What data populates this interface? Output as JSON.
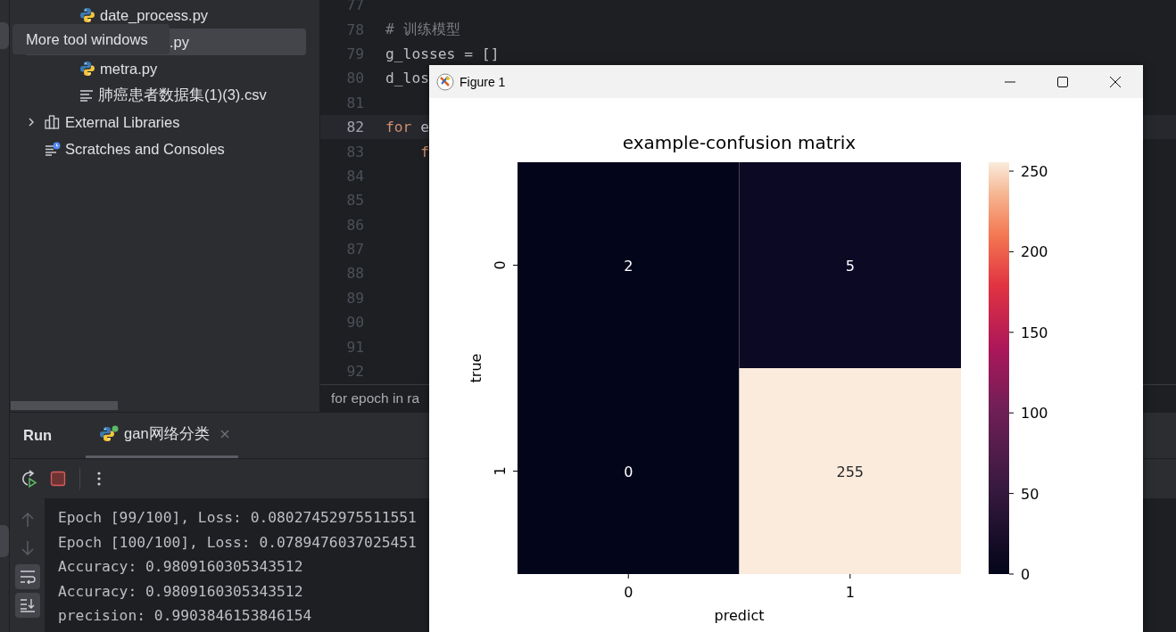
{
  "tooltip": {
    "text": "More tool windows"
  },
  "project_tree": {
    "items": [
      {
        "kind": "python",
        "label": "date_process.py",
        "selected": false
      },
      {
        "kind": "hidden",
        "label": ".py",
        "selected": true
      },
      {
        "kind": "python",
        "label": "metra.py",
        "selected": false
      },
      {
        "kind": "text",
        "label": "肺癌患者数据集(1)(3).csv",
        "selected": false
      },
      {
        "kind": "library",
        "label": "External Libraries",
        "selected": false,
        "expanded": false
      },
      {
        "kind": "scratches",
        "label": "Scratches and Consoles",
        "selected": false
      }
    ]
  },
  "editor": {
    "lines": [
      {
        "number": "77",
        "current": false
      },
      {
        "number": "78",
        "current": false,
        "tokens": [
          {
            "kind": "comment",
            "text": "# 训练模型"
          }
        ]
      },
      {
        "number": "79",
        "current": false,
        "tokens": [
          {
            "kind": "plain",
            "text": "g_losses = []"
          }
        ]
      },
      {
        "number": "80",
        "current": false,
        "tokens": [
          {
            "kind": "plain",
            "text": "d_los"
          }
        ]
      },
      {
        "number": "81",
        "current": false
      },
      {
        "number": "82",
        "current": true,
        "tokens": [
          {
            "kind": "keyword",
            "text": "for"
          },
          {
            "kind": "plain",
            "text": " e"
          }
        ]
      },
      {
        "number": "83",
        "current": false,
        "tokens": [
          {
            "kind": "keyword",
            "text": "    f"
          }
        ]
      },
      {
        "number": "84",
        "current": false
      },
      {
        "number": "85",
        "current": false
      },
      {
        "number": "86",
        "current": false
      },
      {
        "number": "87",
        "current": false
      },
      {
        "number": "88",
        "current": false
      },
      {
        "number": "89",
        "current": false
      },
      {
        "number": "90",
        "current": false
      },
      {
        "number": "91",
        "current": false
      },
      {
        "number": "92",
        "current": false
      }
    ],
    "breadcrumb": "for epoch in ra"
  },
  "run_panel": {
    "title": "Run",
    "tabs": [
      {
        "label": "gan网络分类",
        "selected": true
      }
    ],
    "console": [
      "Epoch [99/100], Loss: 0.08027452975511551",
      "Epoch [100/100], Loss: 0.0789476037025451",
      "Accuracy: 0.9809160305343512",
      "Accuracy: 0.9809160305343512",
      "precision: 0.9903846153846154"
    ]
  },
  "figure": {
    "title": "Figure 1",
    "heatmap": {
      "title": "example-confusion matrix",
      "xlabel": "predict",
      "ylabel": "true",
      "xticks": [
        "0",
        "1"
      ],
      "yticks": [
        "0",
        "1"
      ],
      "cells": [
        [
          {
            "text": "2",
            "color": "#03051a"
          },
          {
            "text": "5",
            "color": "#0b0923"
          }
        ],
        [
          {
            "text": "0",
            "color": "#03051a"
          },
          {
            "text": "255",
            "color": "#faebdd"
          }
        ]
      ],
      "colorbar_ticks": [
        "250",
        "200",
        "150",
        "100",
        "50",
        "0"
      ]
    }
  }
}
